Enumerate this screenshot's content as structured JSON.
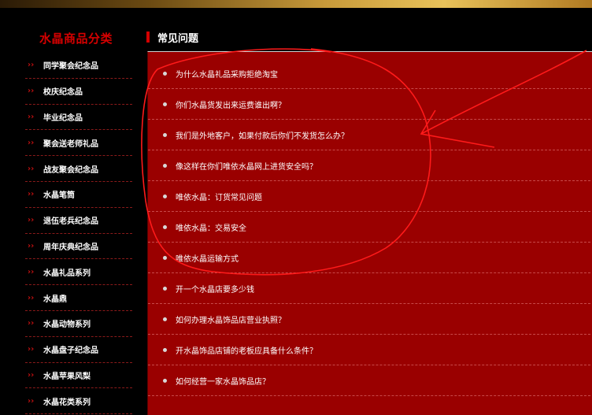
{
  "sidebar": {
    "title": "水晶商品分类",
    "items": [
      {
        "label": "同学聚会纪念品"
      },
      {
        "label": "校庆纪念品"
      },
      {
        "label": "毕业纪念品"
      },
      {
        "label": "聚会送老师礼品"
      },
      {
        "label": "战友聚会纪念品"
      },
      {
        "label": "水晶笔筒"
      },
      {
        "label": "退伍老兵纪念品"
      },
      {
        "label": "周年庆典纪念品"
      },
      {
        "label": "水晶礼品系列"
      },
      {
        "label": "水晶鼎"
      },
      {
        "label": "水晶动物系列"
      },
      {
        "label": "水晶盘子纪念品"
      },
      {
        "label": "水晶苹果风梨"
      },
      {
        "label": "水晶花类系列"
      }
    ],
    "arrow_glyph": "››"
  },
  "main": {
    "title": "常见问题",
    "faq": [
      {
        "label": "为什么水晶礼品采购拒绝淘宝"
      },
      {
        "label": "你们水晶货发出来运费谁出啊？"
      },
      {
        "label": "我们是外地客户，如果付款后你们不发货怎么办？"
      },
      {
        "label": "像这样在你们唯依水晶网上进货安全吗？"
      },
      {
        "label": "唯依水晶：订货常见问题"
      },
      {
        "label": "唯依水晶：交易安全"
      },
      {
        "label": "唯依水晶运输方式"
      },
      {
        "label": "开一个水晶店要多少钱"
      },
      {
        "label": "如何办理水晶饰品店营业执照？"
      },
      {
        "label": "开水晶饰品店铺的老板应具备什么条件？"
      },
      {
        "label": "如何经营一家水晶饰品店？"
      }
    ]
  },
  "colors": {
    "accent_red": "#d40000",
    "panel_red": "#9a0000",
    "annotation_red": "#ff1a1a"
  }
}
